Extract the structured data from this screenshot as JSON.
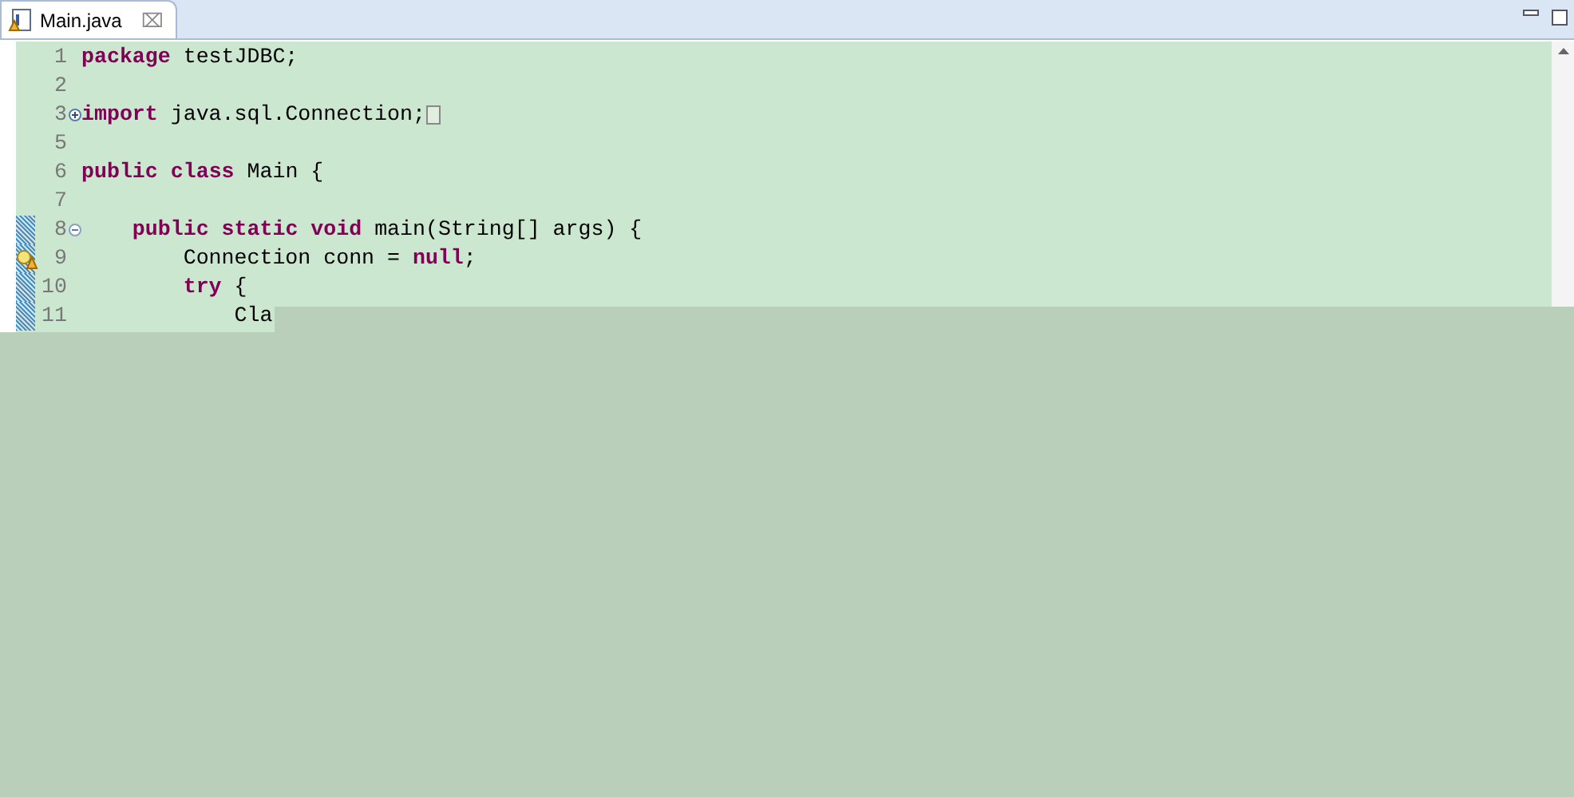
{
  "tab": {
    "title": "Main.java",
    "close": "⌧",
    "selected": true
  },
  "lines": [
    {
      "number": "1",
      "code": "**package** testJDBC;",
      "changed": false
    },
    {
      "number": "2",
      "changed": false
    },
    {
      "number": "3",
      "code": "**import** java.sql.Connection;",
      "changed": false,
      "folded": true
    },
    {
      "number": "5",
      "changed": false
    },
    {
      "number": "6",
      "code": "**public** **class** Main {",
      "changed": false
    },
    {
      "number": "7",
      "changed": false
    },
    {
      "number": "8",
      "code": "    **public** **static** **void** main(String[] args) {",
      "changed": true,
      "folded": false
    },
    {
      "number": "9",
      "code": "        Connection conn = **null**;",
      "changed": true,
      "warning": true
    },
    {
      "number": "10",
      "code": "        **try** {",
      "changed": true
    },
    {
      "number": "11",
      "code": "            Cla",
      "changed": true
    }
  ]
}
